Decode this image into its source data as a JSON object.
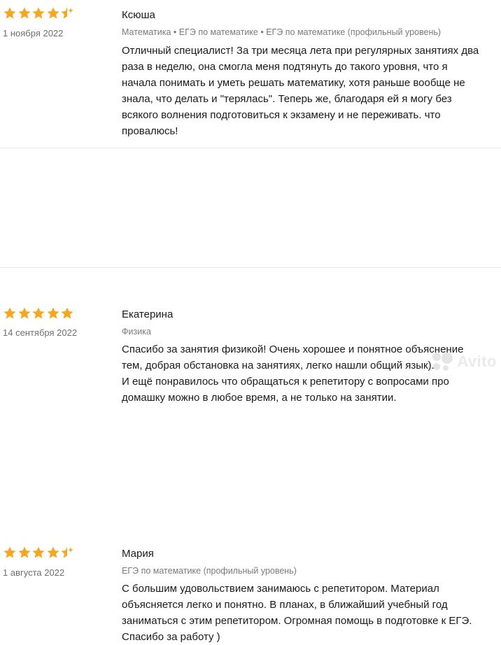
{
  "colors": {
    "star": "#f5a623",
    "star_empty": "#f0d9a8",
    "tag_text": "#7a7a7a",
    "date_text": "#6e6e6e"
  },
  "reviews": [
    {
      "rating": 4.5,
      "date": "1 ноября 2022",
      "name": "Ксюша",
      "tags": "Математика • ЕГЭ по математике • ЕГЭ по математике (профильный уровень)",
      "lines": [
        "Отличный специалист! За три месяца лета при регулярных занятиях два",
        "раза в неделю, она смогла меня подтянуть до такого уровня, что я",
        "начала понимать и уметь решать математику, хотя раньше вообще не",
        "знала, что делать и \"терялась\". Теперь же, благодаря ей я могу без",
        "всякого волнения подготовиться к экзамену и не переживать. что",
        "провалюсь!"
      ]
    },
    {
      "rating": 5,
      "date": "14 сентября 2022",
      "name": "Екатерина",
      "tags": "Физика",
      "lines": [
        "Спасибо за занятия физикой! Очень хорошее и понятное объяснение",
        "тем, добрая обстановка на занятиях, легко нашли общий язык).",
        "И ещё понравилось что обращаться к репетитору с вопросами про",
        "домашку можно в любое время, а не только на занятии."
      ]
    },
    {
      "rating": 4.5,
      "date": "1 августа 2022",
      "name": "Мария",
      "tags": "ЕГЭ по математике (профильный уровень)",
      "lines": [
        "С большим удовольствием занимаюсь с репетитором. Материал",
        "объясняется легко и понятно. В планах, в ближайший учебный год",
        "заниматься с этим репетитором. Огромная помощь в подготовке к ЕГЭ.",
        "Спасибо за работу )"
      ]
    }
  ],
  "watermark": {
    "text": "Avito",
    "icon": "avito-logo-icon"
  }
}
